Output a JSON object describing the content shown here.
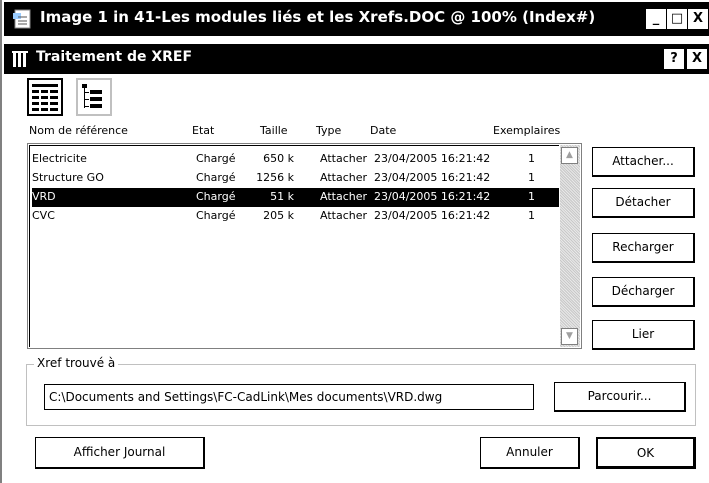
{
  "window": {
    "title": "Image 1 in 41-Les modules liés et les Xrefs.DOC @ 100% (Index#)",
    "minimize": "_",
    "maximize": "□",
    "close": "X"
  },
  "dialog": {
    "title": "Traitement de XREF",
    "help": "?",
    "close": "X"
  },
  "columns": {
    "name": "Nom de référence",
    "state": "Etat",
    "size": "Taille",
    "type": "Type",
    "date": "Date",
    "copies": "Exemplaires"
  },
  "rows": [
    {
      "name": "Electricite",
      "state": "Chargé",
      "size": "650 k",
      "type": "Attacher",
      "date": "23/04/2005 16:21:42",
      "copies": "1",
      "selected": false
    },
    {
      "name": "Structure GO",
      "state": "Chargé",
      "size": "1256 k",
      "type": "Attacher",
      "date": "23/04/2005 16:21:42",
      "copies": "1",
      "selected": false
    },
    {
      "name": "VRD",
      "state": "Chargé",
      "size": "51 k",
      "type": "Attacher",
      "date": "23/04/2005 16:21:42",
      "copies": "1",
      "selected": true
    },
    {
      "name": "CVC",
      "state": "Chargé",
      "size": "205 k",
      "type": "Attacher",
      "date": "23/04/2005 16:21:42",
      "copies": "1",
      "selected": false
    }
  ],
  "buttons": {
    "attach": "Attacher...",
    "detach": "Détacher",
    "reload": "Recharger",
    "unload": "Décharger",
    "bind": "Lier",
    "browse": "Parcourir...",
    "show_log": "Afficher Journal",
    "cancel": "Annuler",
    "ok": "OK"
  },
  "xref_found": {
    "label": "Xref trouvé à",
    "path": "C:\\Documents and Settings\\FC-CadLink\\Mes documents\\VRD.dwg"
  },
  "view_mode": {
    "list_view_icon": "list-view-icon",
    "tree_view_icon": "tree-view-icon",
    "active": "list"
  },
  "scroll": {
    "up_arrow": "▲",
    "down_arrow": "▼"
  }
}
